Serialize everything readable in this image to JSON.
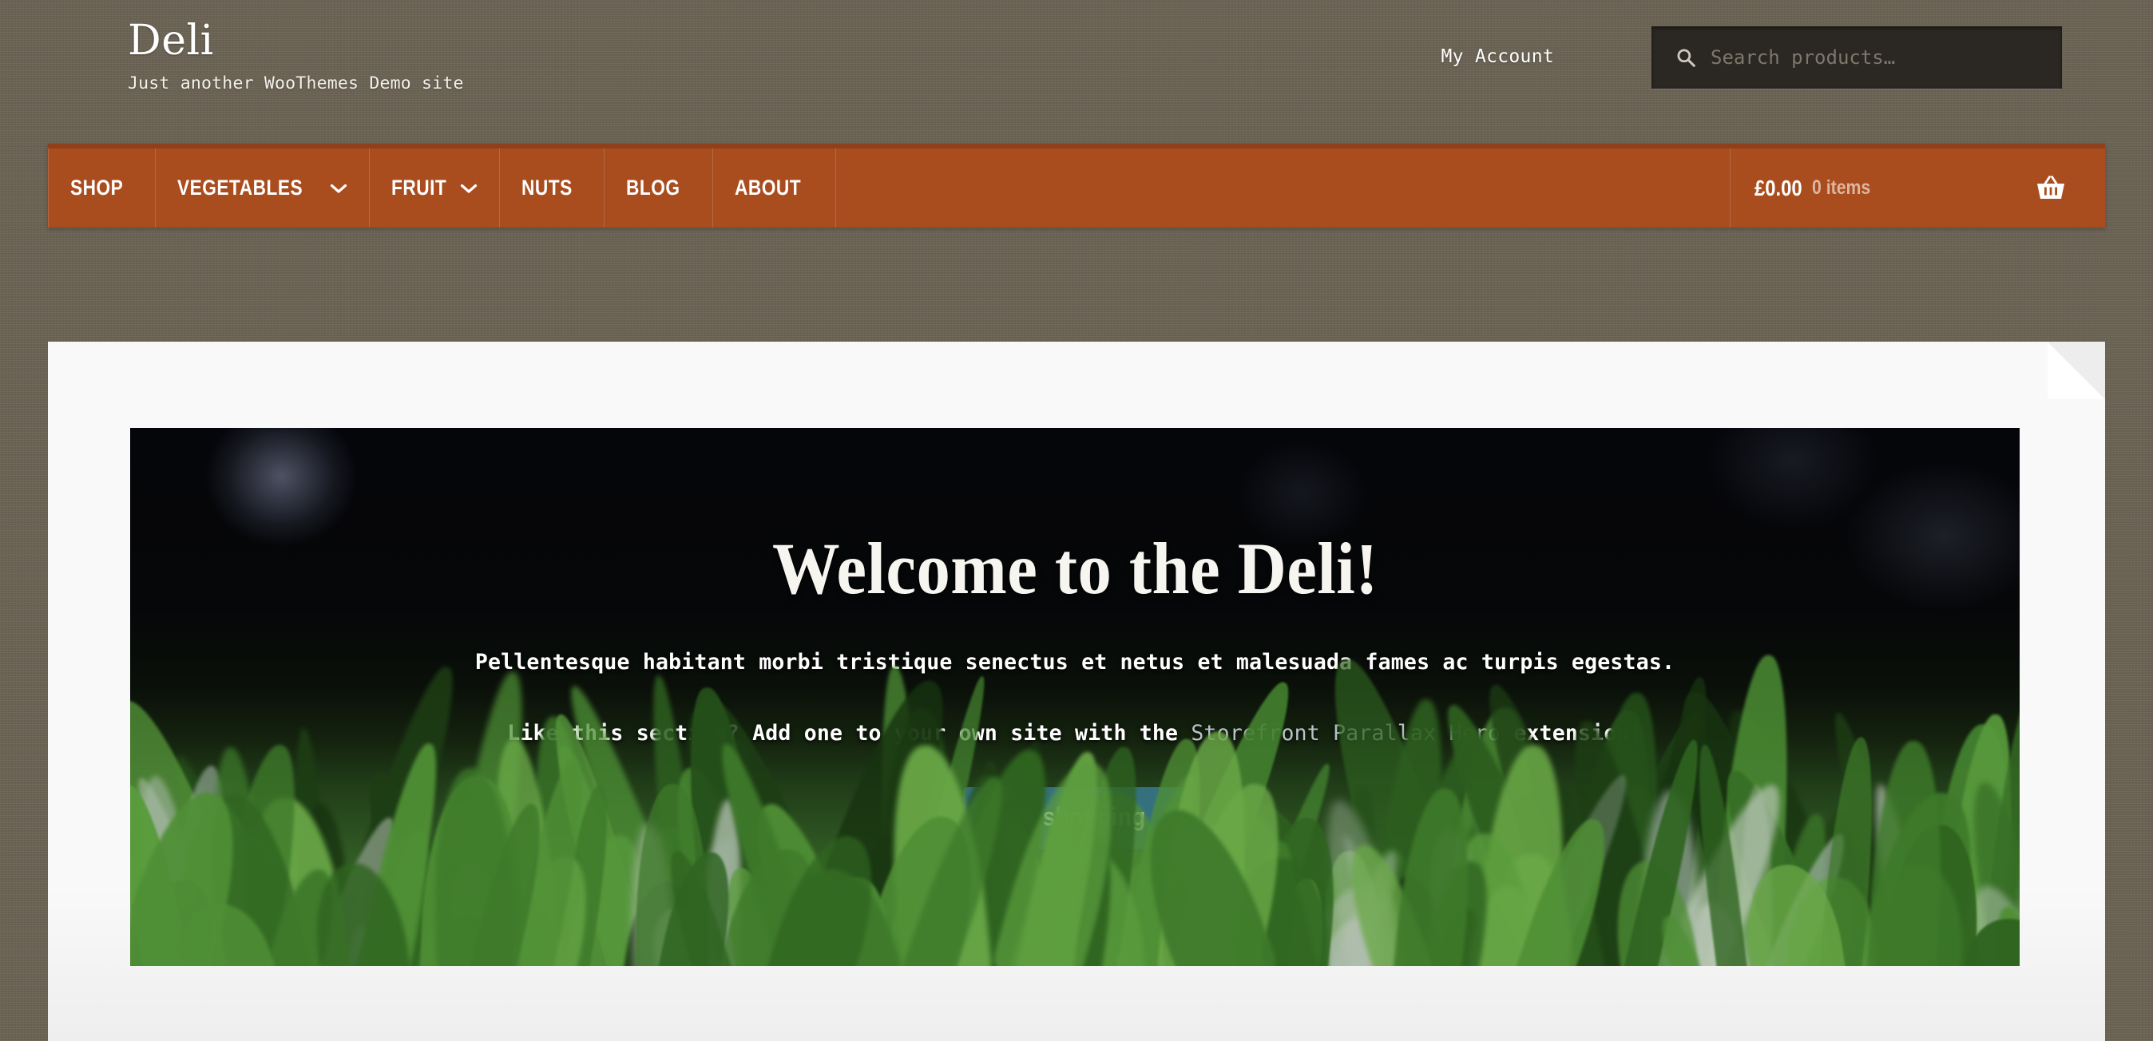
{
  "theme": {
    "background": "#6b6354",
    "nav_background": "#a94d1f",
    "nav_border": "#8f3f19",
    "button_teal": "#35707f",
    "content_background": "#f9f9f9",
    "search_background": "#2b2823"
  },
  "header": {
    "site_title": "Deli",
    "tagline": "Just another WooThemes Demo site",
    "my_account_label": "My Account",
    "search": {
      "placeholder": "Search products…",
      "value": "",
      "icon": "search-icon"
    }
  },
  "nav": {
    "items": [
      {
        "label": "SHOP",
        "has_dropdown": false
      },
      {
        "label": "VEGETABLES",
        "has_dropdown": true
      },
      {
        "label": "FRUIT",
        "has_dropdown": true
      },
      {
        "label": "NUTS",
        "has_dropdown": false
      },
      {
        "label": "BLOG",
        "has_dropdown": false
      },
      {
        "label": "ABOUT",
        "has_dropdown": false
      }
    ],
    "cart": {
      "amount": "£0.00",
      "items_label": "0 items",
      "icon": "shopping-basket-icon"
    }
  },
  "hero": {
    "title": "Welcome to the Deli!",
    "subtitle": "Pellentesque habitant morbi tristique senectus et netus et malesuada fames ac turpis egestas.",
    "promo_prefix": "Like this section? Add one to your own site with the ",
    "promo_link": "Storefront Parallax Hero",
    "promo_suffix": " extension!",
    "button_label": "Go shopping"
  }
}
